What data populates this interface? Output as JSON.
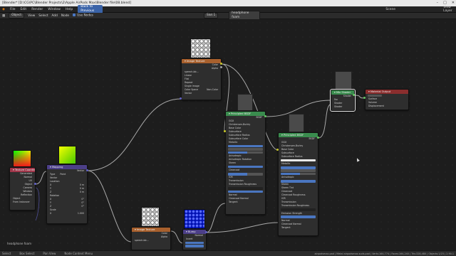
{
  "window": {
    "title": "[Blender* [D:\\CG\\PC\\Blender Projects\\2\\Apple AirPods Max\\Blender file\\08.blend]",
    "controls": [
      "–",
      "□",
      "✕"
    ]
  },
  "menubar": {
    "items": [
      "File",
      "Edit",
      "Render",
      "Window",
      "Help"
    ],
    "workspace": "Back to Previous",
    "scene": "Scene",
    "view_layer": "View Layer"
  },
  "header": {
    "editor_type": "Object",
    "menus": [
      "View",
      "Select",
      "Add",
      "Node"
    ],
    "use_nodes": "Use Nodes",
    "slot": "Slot 1",
    "material": "headphone foam"
  },
  "nodes": {
    "image_tex_top": {
      "title": "▾ Image Texture",
      "out_color": "Color",
      "out_alpha": "Alpha",
      "image": "speech-bb...",
      "interp": "Linear",
      "proj": "Flat",
      "ext": "Repeat",
      "src": "Single Image",
      "cs_label": "Color Space",
      "cs_value": "Non-Color",
      "vector": "Vector"
    },
    "principled_1": {
      "title": "▾ Principled BSDF",
      "out": "BSDF",
      "dist": "GGX",
      "sss": "Christensen-Burley",
      "base_color": "Base Color",
      "rows": [
        "Subsurface",
        "Subsurface Radius",
        "Subsurface Color",
        "Metallic",
        "Specular",
        "Specular Tint",
        "Roughness",
        "Anisotropic",
        "Anisotropic Rotation",
        "Sheen",
        "Sheen Tint",
        "Clearcoat",
        "Clearcoat Roughness",
        "IOR",
        "Transmission",
        "Transmission Roughness",
        "Emission",
        "Alpha",
        "Normal",
        "Clearcoat Normal",
        "Tangent"
      ]
    },
    "principled_2": {
      "title": "▾ Principled BSDF",
      "out": "BSDF",
      "dist": "GGX",
      "sss": "Christensen-Burley",
      "base_color": "Base Color",
      "rows": [
        "Subsurface",
        "Subsurface Radius",
        "Subsurface Color",
        "Metallic",
        "Specular",
        "Specular Tint",
        "Roughness",
        "Anisotropic",
        "Anisotropic Rotation",
        "Sheen",
        "Sheen Tint",
        "Clearcoat",
        "Clearcoat Roughness",
        "IOR",
        "Transmission",
        "Transmission Roughness",
        "Emission",
        "Emission Strength",
        "Alpha",
        "Normal",
        "Clearcoat Normal",
        "Tangent"
      ]
    },
    "mix_shader": {
      "title": "▾ Mix Shader",
      "out": "Shader",
      "in": [
        "Fac",
        "Shader",
        "Shader"
      ]
    },
    "material_output": {
      "title": "▾ Material Output",
      "target": "All",
      "in": [
        "Surface",
        "Volume",
        "Displacement"
      ]
    },
    "texcoord": {
      "title": "▾ Texture Coordinate",
      "outs": [
        "Generated",
        "Normal",
        "UV",
        "Object",
        "Camera",
        "Window",
        "Reflection"
      ],
      "object_label": "Object",
      "from_instancer": "From Instancer"
    },
    "mapping": {
      "title": "▾ Mapping",
      "out": "Vector",
      "type_label": "Type",
      "type_value": "Point",
      "vector": "Vector",
      "location": "Location",
      "rotation": "Rotation",
      "scale": "Scale",
      "xyz": [
        "X",
        "Y",
        "Z"
      ],
      "loc_vals": [
        "0 m",
        "0 m",
        "0 m"
      ],
      "rot_vals": [
        "0°",
        "0°",
        "0°"
      ],
      "scale_vals": [
        "1.000",
        "1.000",
        "1.000"
      ]
    },
    "image_tex_bottom": {
      "title": "▾ Image Texture",
      "out_color": "Color",
      "out_alpha": "Alpha",
      "image": "speech-bb..."
    },
    "bump": {
      "title": "▾ Bump",
      "out": "Normal",
      "invert": "Invert",
      "strength": "Strength",
      "distance": "Distance"
    }
  },
  "frame_label": "headphone foam",
  "statusbar": {
    "items": [
      "Select",
      "Box Select",
      "Pan View",
      "Node Context Menu"
    ],
    "right": "airpodsmax.pad | Metal airpodsmax.suds.pad | Verts:164,774 | Faces:164,240 | Tris:328,480 | Objects:1/23 | 2.90.1"
  },
  "colors": {
    "texture_header": "#a8602d",
    "shader_header": "#3a8c4e",
    "input_header": "#a0364a",
    "vector_header": "#4c3f88",
    "output_header": "#8a2e2e",
    "socket_color": "#c7c729",
    "socket_shader": "#63c763",
    "socket_vector": "#6363c7"
  }
}
